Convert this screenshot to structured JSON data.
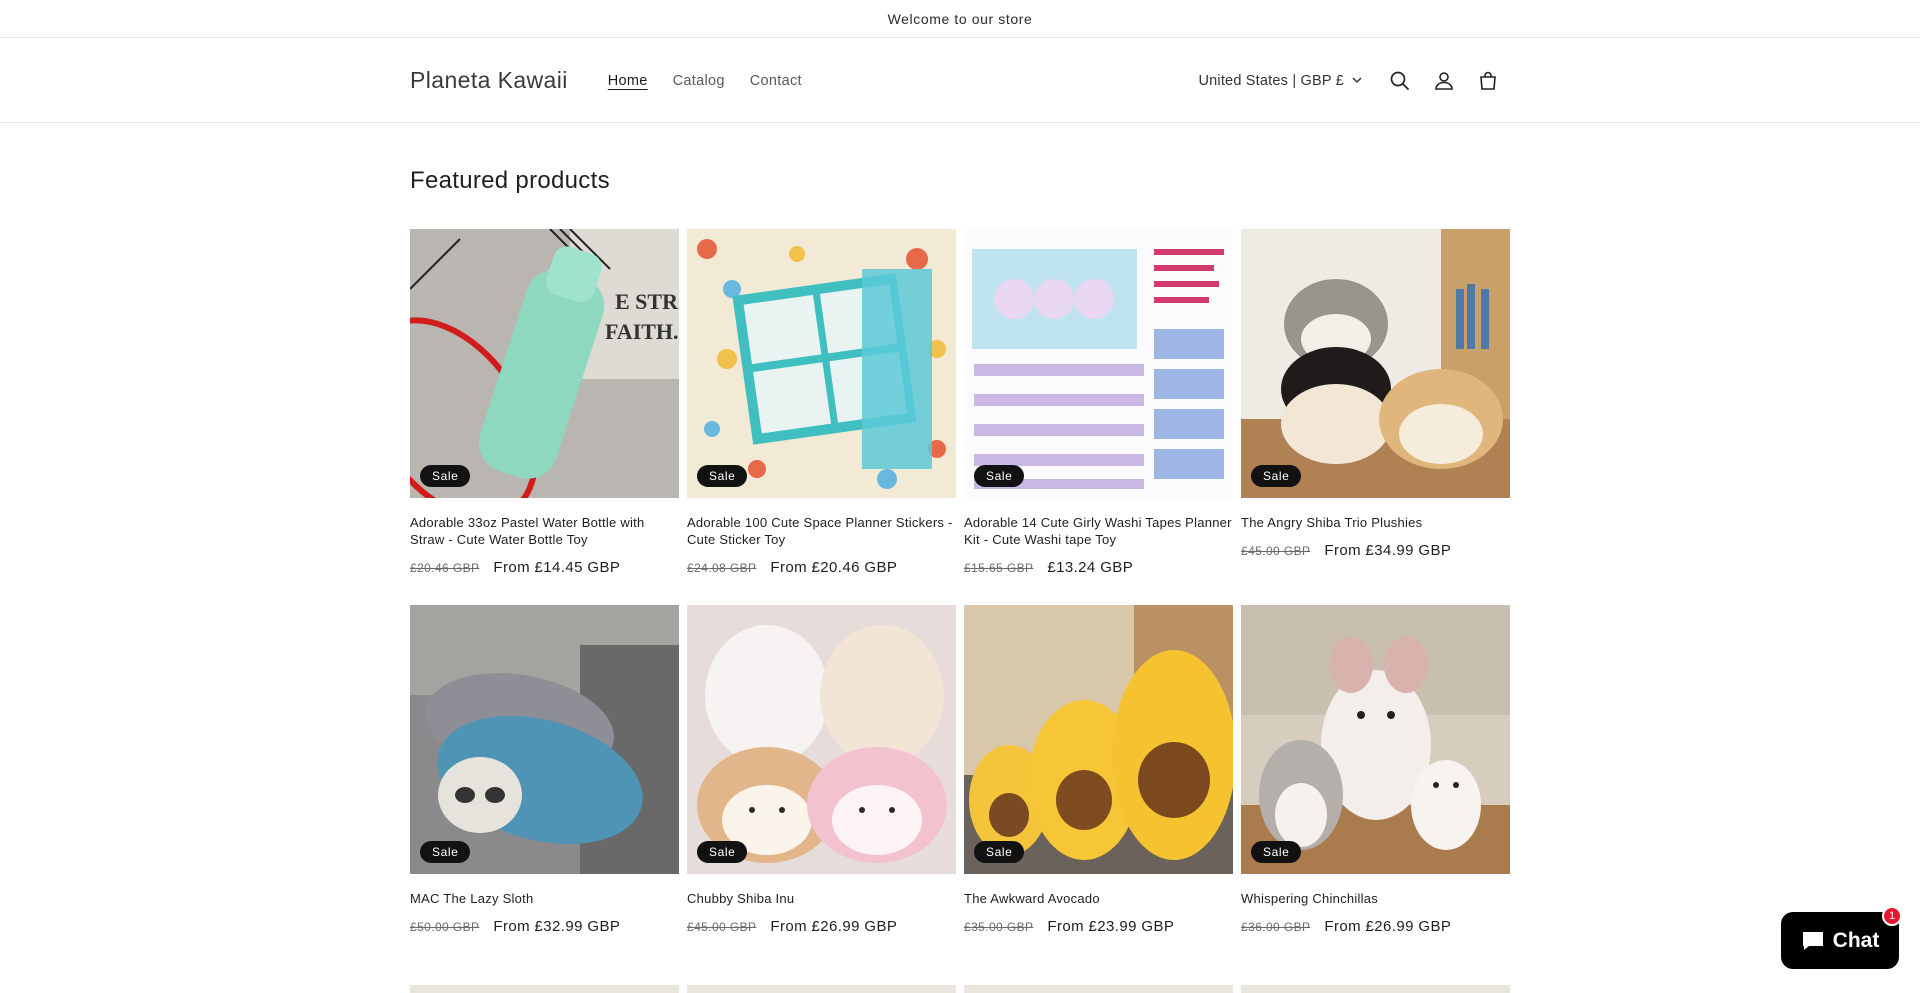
{
  "announcement": "Welcome to our store",
  "header": {
    "logo": "Planeta Kawaii",
    "nav": [
      "Home",
      "Catalog",
      "Contact"
    ],
    "locale": "United States | GBP £"
  },
  "featured": {
    "title": "Featured products",
    "badge": "Sale",
    "products": [
      {
        "title": "Adorable 33oz Pastel Water Bottle with Straw - Cute Water Bottle Toy",
        "old": "£20.46 GBP",
        "now": "From £14.45 GBP"
      },
      {
        "title": "Adorable 100 Cute Space Planner Stickers - Cute Sticker Toy",
        "old": "£24.08 GBP",
        "now": "From £20.46 GBP"
      },
      {
        "title": "Adorable 14 Cute Girly Washi Tapes Planner Kit - Cute Washi tape Toy",
        "old": "£15.65 GBP",
        "now": "£13.24 GBP"
      },
      {
        "title": "The Angry Shiba Trio Plushies",
        "old": "£45.00 GBP",
        "now": "From £34.99 GBP"
      },
      {
        "title": "MAC The Lazy Sloth",
        "old": "£50.00 GBP",
        "now": "From £32.99 GBP"
      },
      {
        "title": "Chubby Shiba Inu",
        "old": "£45.00 GBP",
        "now": "From £26.99 GBP"
      },
      {
        "title": "The Awkward Avocado",
        "old": "£35.00 GBP",
        "now": "From £23.99 GBP"
      },
      {
        "title": "Whispering Chinchillas",
        "old": "£36.00 GBP",
        "now": "From £26.99 GBP"
      }
    ]
  },
  "chat": {
    "label": "Chat",
    "count": "1"
  }
}
